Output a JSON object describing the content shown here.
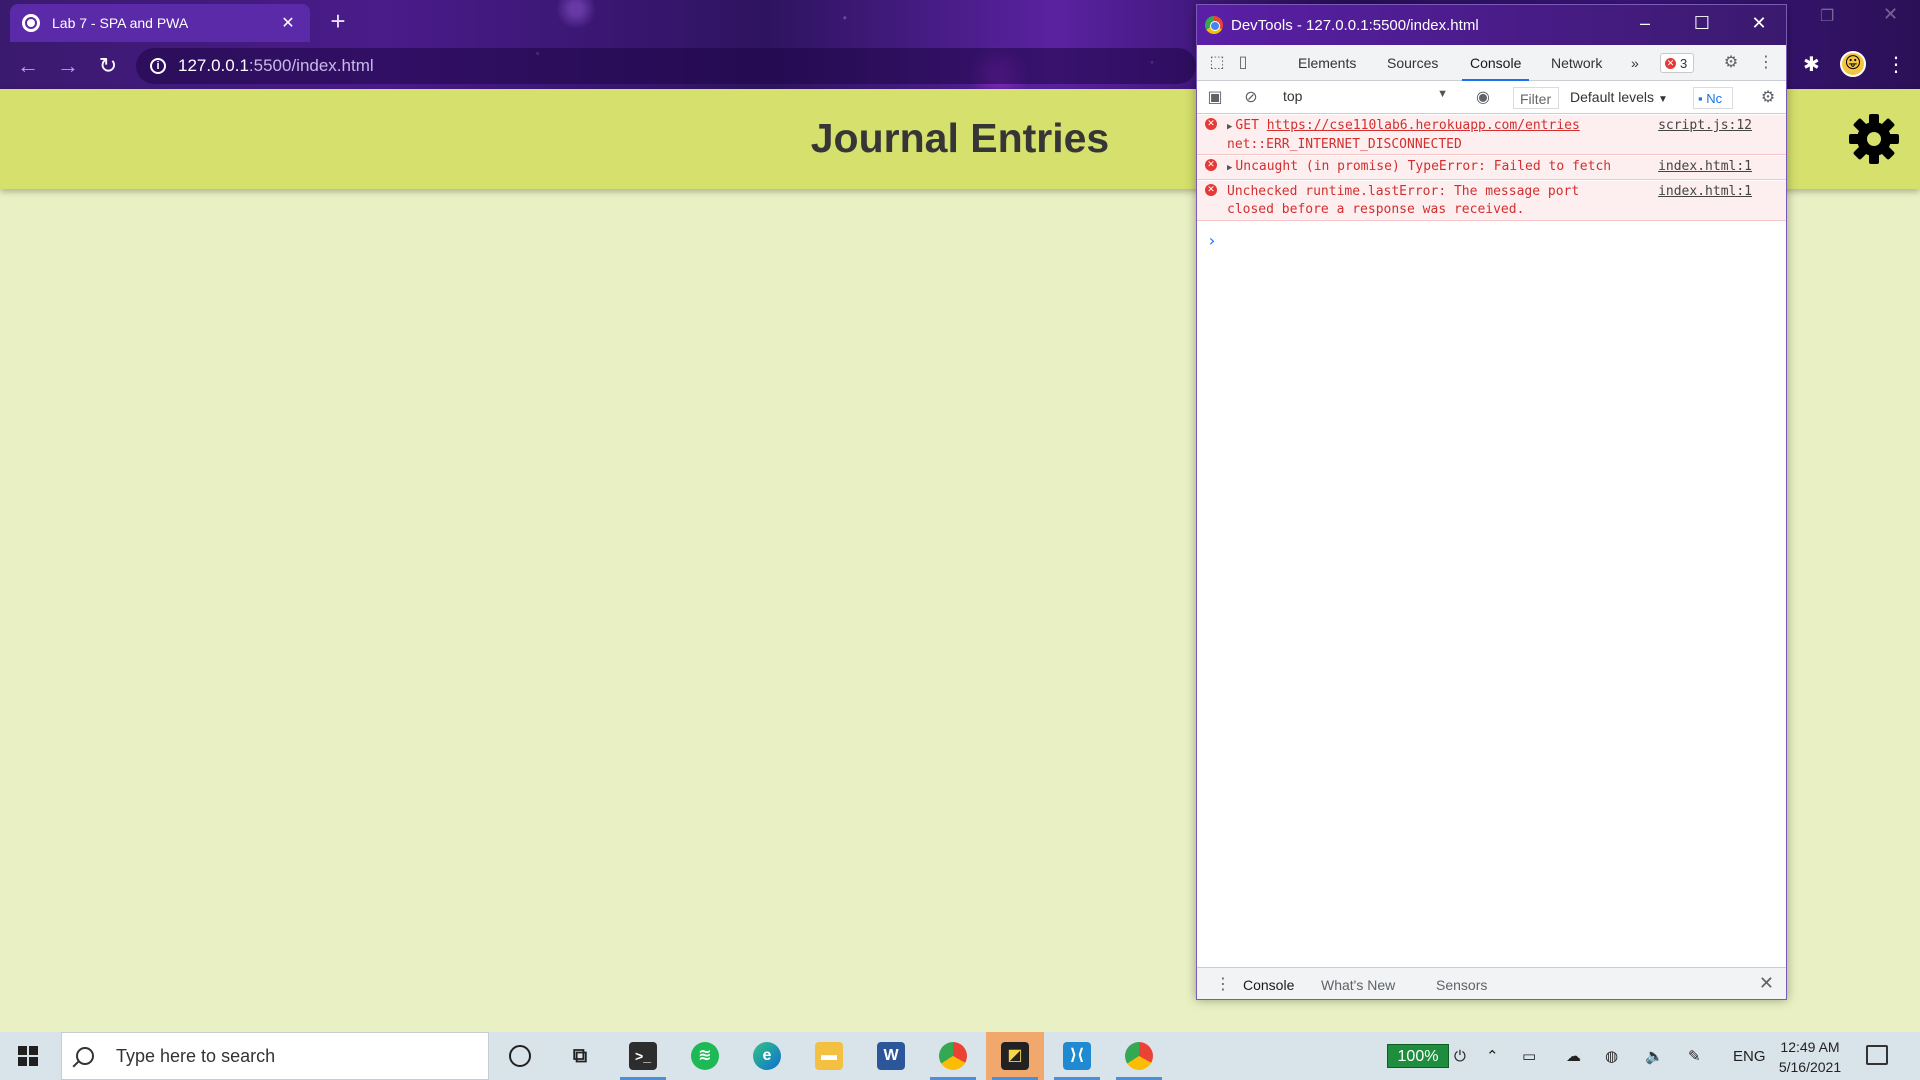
{
  "browser": {
    "tab_title": "Lab 7 - SPA and PWA",
    "tab_close": "✕",
    "new_tab": "+",
    "url_host": "127.0.0.1",
    "url_path": ":5500/index.html"
  },
  "page": {
    "title": "Journal Entries"
  },
  "devtools": {
    "window_title": "DevTools - 127.0.0.1:5500/index.html",
    "tabs": [
      "Elements",
      "Sources",
      "Console",
      "Network"
    ],
    "more_tabs": "»",
    "error_count": "3",
    "context": "top",
    "filter_placeholder": "Filter",
    "levels": "Default levels",
    "issues": "Nc",
    "logs": [
      {
        "prefix": "GET ",
        "link": "https://cse110lab6.herokuapp.com/entries",
        "rest": "\nnet::ERR_INTERNET_DISCONNECTED",
        "source": "script.js:12"
      },
      {
        "prefix": "Uncaught (in promise) TypeError: Failed to fetch",
        "source": "index.html:1"
      },
      {
        "prefix": "Unchecked runtime.lastError: The message port\nclosed before a response was received.",
        "source": "index.html:1"
      }
    ],
    "prompt": "›",
    "drawer_tabs": [
      "Console",
      "What's New",
      "Sensors"
    ]
  },
  "taskbar": {
    "search_placeholder": "Type here to search",
    "battery": "100%",
    "language": "ENG",
    "time": "12:49 AM",
    "date": "5/16/2021"
  },
  "colors": {
    "page_bg": "#e9f1c4",
    "header_bg": "#d5e06d",
    "error_text": "#d32f2f",
    "accent": "#1a73e8"
  }
}
